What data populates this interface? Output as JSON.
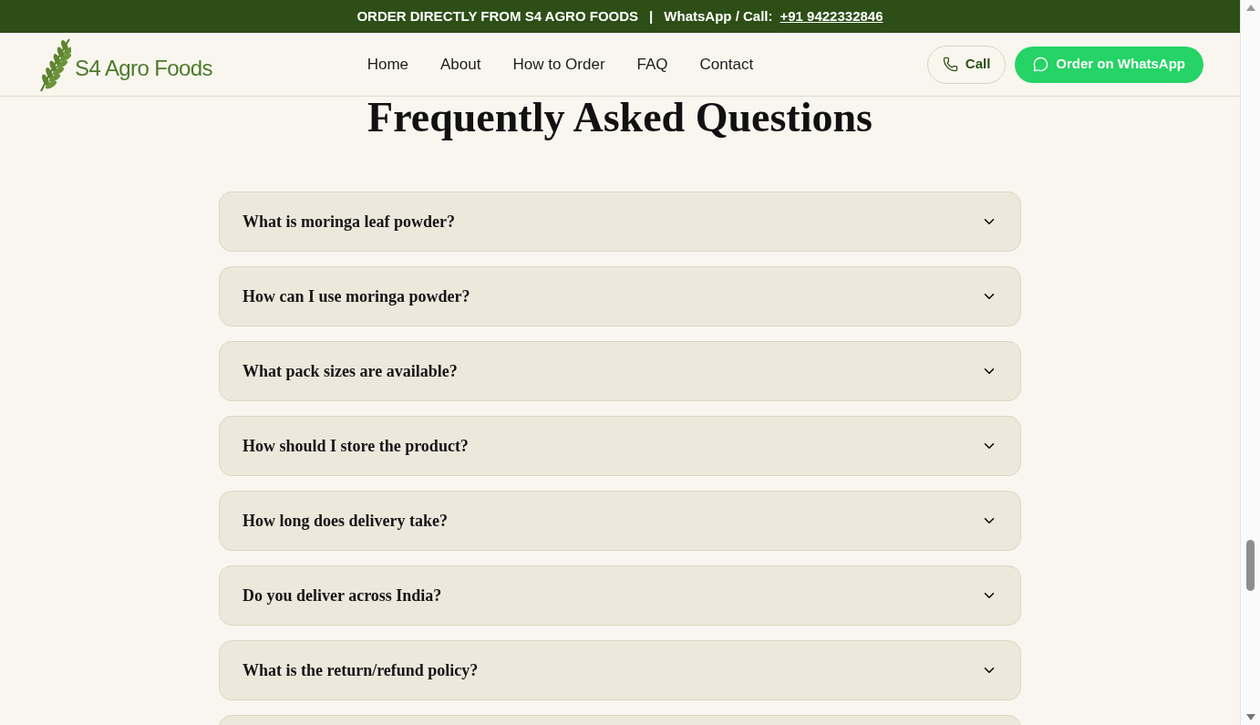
{
  "announcement": {
    "text": "ORDER DIRECTLY FROM S4 AGRO FOODS",
    "separator": "|",
    "contact_label": "WhatsApp / Call:",
    "phone": "+91 9422332846"
  },
  "header": {
    "logo": "S4 Agro Foods",
    "nav": [
      {
        "label": "Home"
      },
      {
        "label": "About"
      },
      {
        "label": "How to Order"
      },
      {
        "label": "FAQ"
      },
      {
        "label": "Contact"
      }
    ],
    "call_button": "Call",
    "whatsapp_button": "Order on WhatsApp"
  },
  "faq": {
    "title": "Frequently Asked Questions",
    "items": [
      {
        "question": "What is moringa leaf powder?",
        "expanded": false
      },
      {
        "question": "How can I use moringa powder?",
        "expanded": false
      },
      {
        "question": "What pack sizes are available?",
        "expanded": false
      },
      {
        "question": "How should I store the product?",
        "expanded": false
      },
      {
        "question": "How long does delivery take?",
        "expanded": false
      },
      {
        "question": "Do you deliver across India?",
        "expanded": false
      },
      {
        "question": "What is the return/refund policy?",
        "expanded": false
      }
    ]
  }
}
